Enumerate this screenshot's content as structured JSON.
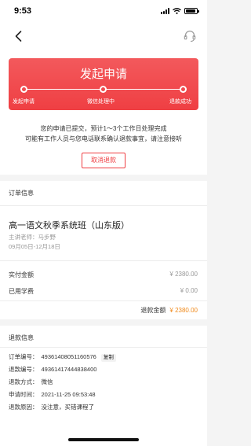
{
  "status_bar": {
    "time": "9:53"
  },
  "progress": {
    "title": "发起申请",
    "steps": [
      "发起申请",
      "微信处理中",
      "退款成功"
    ]
  },
  "notice": {
    "line1": "您的申请已提交，预计1～3个工作日处理完成",
    "line2": "可能有工作人员与您电话联系确认退款事宜，请注意接听"
  },
  "cancel_button": "取消退款",
  "order_info": {
    "section_title": "订单信息",
    "course_title": "高一语文秋季系统班（山东版）",
    "teacher": "主讲老师：马步野",
    "date_range": "09月05日-12月18日",
    "paid_label": "实付金额",
    "paid_value": "¥ 2380.00",
    "used_label": "已用学费",
    "used_value": "¥ 0.00",
    "refund_label": "退款金额",
    "refund_value": "¥ 2380.00"
  },
  "refund_info": {
    "section_title": "退款信息",
    "order_no_label": "订单编号：",
    "order_no": "49361408051160576",
    "copy_label": "复制",
    "refund_no_label": "退款编号：",
    "refund_no": "49361417444838400",
    "method_label": "退款方式：",
    "method": "微信",
    "time_label": "申请时间：",
    "time": "2021-11-25 09:53:48",
    "reason_label": "退款原因：",
    "reason": "没注意，买错课程了"
  },
  "colors": {
    "accent": "#ef3f43",
    "amount": "#f08a1c"
  }
}
